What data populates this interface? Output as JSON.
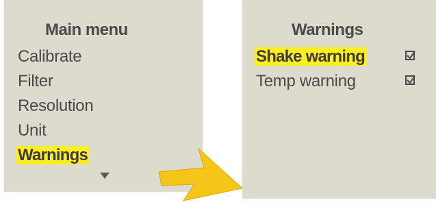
{
  "main_menu": {
    "title": "Main menu",
    "items": [
      {
        "label": "Calibrate"
      },
      {
        "label": "Filter"
      },
      {
        "label": "Resolution"
      },
      {
        "label": "Unit"
      },
      {
        "label": "Warnings"
      }
    ],
    "selected_index": 4
  },
  "warnings_menu": {
    "title": "Warnings",
    "items": [
      {
        "label": "Shake warning",
        "checked": true
      },
      {
        "label": "Temp warning",
        "checked": true
      }
    ],
    "selected_index": 0
  },
  "colors": {
    "screen_bg": "#dcdbcd",
    "highlight": "#ffee22",
    "text": "#4a4a4a",
    "arrow": "#f5c518"
  },
  "icons": {
    "scroll_indicator": "triangle-down-icon",
    "transition": "arrow-right-icon",
    "check": "checkbox-checked-icon"
  }
}
